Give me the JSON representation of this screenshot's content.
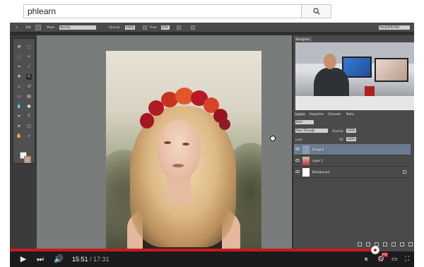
{
  "search": {
    "value": "phlearn",
    "icon": "search-icon"
  },
  "photoshop": {
    "options_bar": {
      "brush_size": "124",
      "mode_label": "Mode:",
      "mode_value": "Normal",
      "opacity_label": "Opacity:",
      "opacity_value": "100%",
      "flow_label": "Flow:",
      "flow_value": "20%",
      "workspace": "PHLEARN ADV"
    },
    "navigator": {
      "tab": "Navigator"
    },
    "layers_panel": {
      "tabs": [
        "Layers",
        "Properties",
        "Channels",
        "Paths"
      ],
      "filter_kind": "Kind",
      "blend_mode": "Pass Through",
      "opacity_label": "Opacity:",
      "opacity_value": "100%",
      "lock_label": "Lock:",
      "fill_label": "Fill:",
      "fill_value": "100%",
      "layers": [
        {
          "name": "Group 4",
          "selected": true
        },
        {
          "name": "Layer 1",
          "selected": false
        },
        {
          "name": "Background",
          "selected": false
        }
      ]
    }
  },
  "player": {
    "current_time": "15:51",
    "separator": " / ",
    "duration": "17:31",
    "progress": 0.904,
    "hd_badge": "HD",
    "icons": {
      "play": "play-icon",
      "next": "next-icon",
      "volume": "volume-icon",
      "captions": "captions-icon",
      "settings": "settings-icon",
      "theater": "theater-mode-icon",
      "fullscreen": "fullscreen-icon"
    }
  }
}
